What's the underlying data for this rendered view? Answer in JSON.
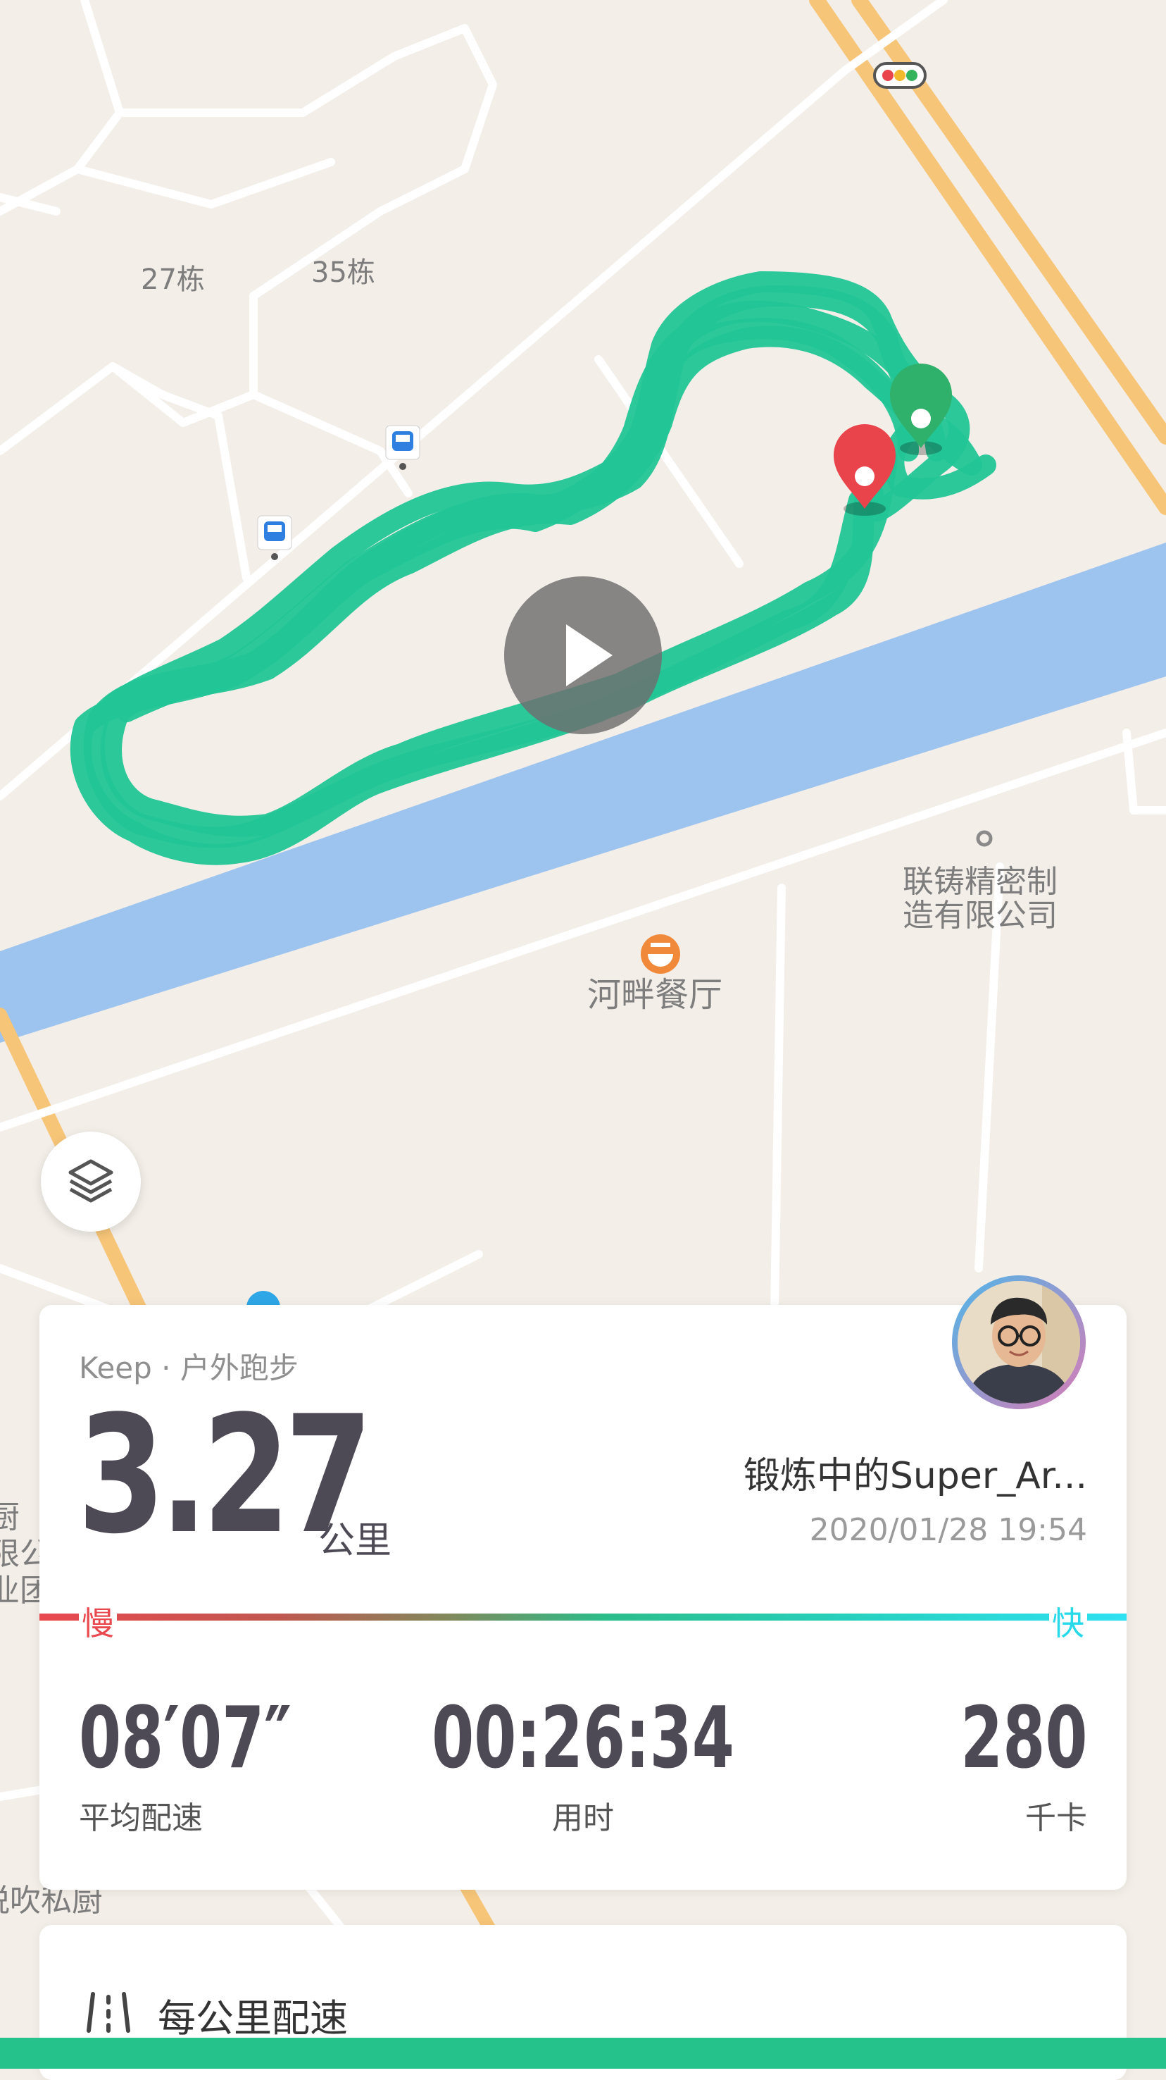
{
  "map": {
    "labels": {
      "building_27": "27栋",
      "building_35": "35栋",
      "company": [
        "联铸精密制",
        "造有限公司"
      ],
      "restaurant": "河畔餐厅",
      "partial_bottom_left": "悦吹私厨",
      "partial_left": [
        "厨",
        "限公",
        "业团"
      ]
    },
    "colors": {
      "ground": "#f3eee8",
      "road": "#ffffff",
      "highway": "#f6c578",
      "river": "#9dc4ef",
      "route": "#22c596",
      "start_pin": "#2fb06b",
      "end_pin": "#e9434b"
    },
    "icons": [
      "bus-stop-icon",
      "traffic-light-icon",
      "restaurant-poi-icon",
      "company-poi-icon",
      "start-pin-icon",
      "end-pin-icon",
      "play-icon",
      "layers-icon"
    ]
  },
  "summary": {
    "source": "Keep · 户外跑步",
    "distance": "3.27",
    "distance_unit": "公里",
    "user_name": "锻炼中的Super_Ar...",
    "datetime": "2020/01/28 19:54",
    "pace_slow_label": "慢",
    "pace_fast_label": "快",
    "stats": [
      {
        "value": "08′07″",
        "label": "平均配速"
      },
      {
        "value": "00:26:34",
        "label": "用时"
      },
      {
        "value": "280",
        "label": "千卡"
      }
    ]
  },
  "splits": {
    "title": "每公里配速"
  }
}
